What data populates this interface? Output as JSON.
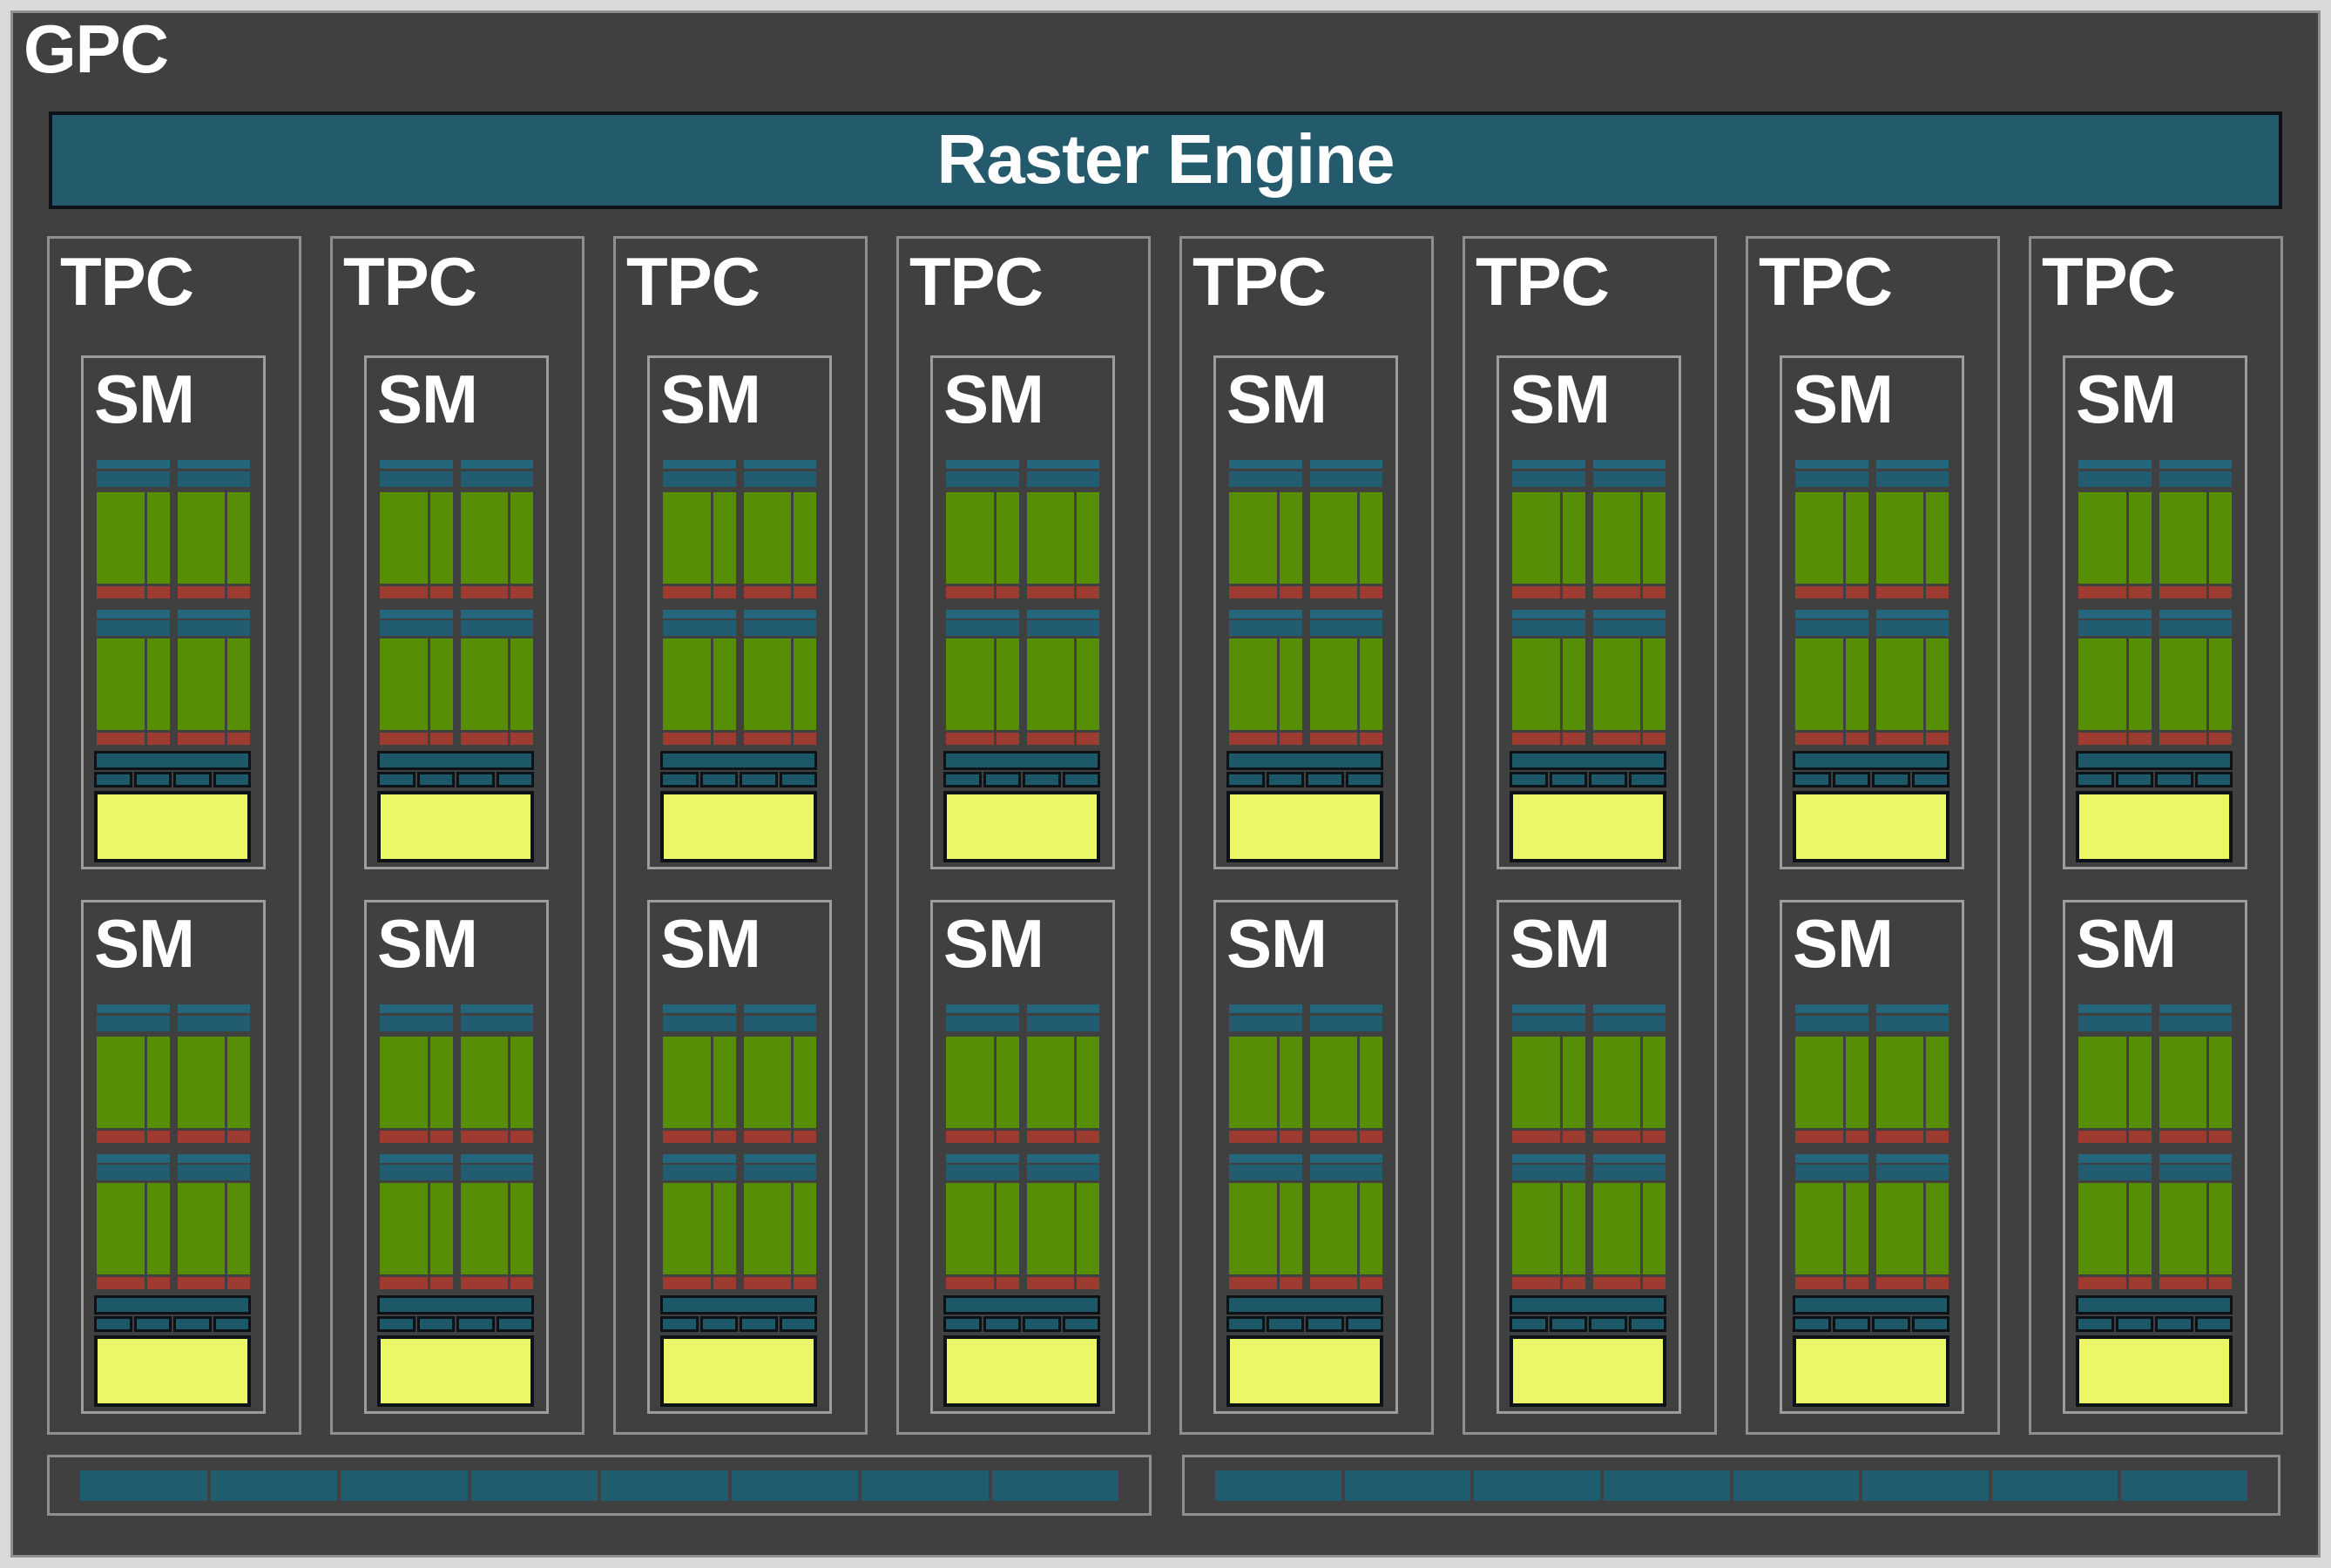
{
  "gpc": {
    "label": "GPC"
  },
  "raster_engine": {
    "label": "Raster Engine"
  },
  "tpcs": {
    "label": "TPC",
    "count": 8,
    "sms_per_tpc": 2
  },
  "sm": {
    "label": "SM",
    "subpartitions": 2,
    "tex_cells": 4
  },
  "bottom_bars": {
    "groups": 2,
    "segments_per_group": 8
  },
  "colors": {
    "frame": "#d9d9d9",
    "bg_dark": "#404040",
    "border_gray": "#8f8f8f",
    "border_light_gray": "#9d9d9d",
    "border_black": "#0d1216",
    "text": "#ffffff",
    "teal_raster": "#235a6c",
    "teal_strip_thin": "#24677c",
    "teal_strip_thick": "#215c70",
    "teal_cache": "#1d5868",
    "teal_segment": "#1f5c6d",
    "green": "#568e05",
    "red": "#9e3b31",
    "yellow": "#ecf767"
  }
}
